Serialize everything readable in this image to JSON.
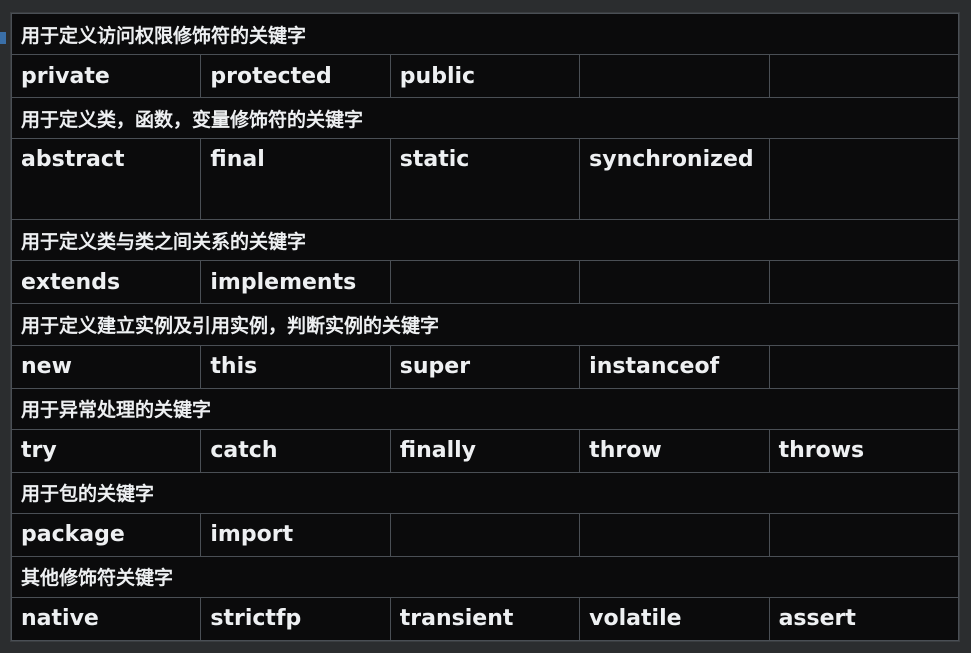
{
  "sections": [
    {
      "category": "用于定义访问权限修饰符的关键字",
      "keywords": [
        "private",
        "protected",
        "public",
        "",
        ""
      ]
    },
    {
      "category": "用于定义类，函数，变量修饰符的关键字",
      "keywords": [
        "abstract",
        "final",
        "static",
        "synchronized",
        ""
      ]
    },
    {
      "category": "用于定义类与类之间关系的关键字",
      "keywords": [
        "extends",
        "implements",
        "",
        "",
        ""
      ]
    },
    {
      "category": "用于定义建立实例及引用实例，判断实例的关键字",
      "keywords": [
        "new",
        "this",
        "super",
        "instanceof",
        ""
      ]
    },
    {
      "category": "用于异常处理的关键字",
      "keywords": [
        "try",
        "catch",
        "finally",
        "throw",
        "throws"
      ]
    },
    {
      "category": "用于包的关键字",
      "keywords": [
        "package",
        "import",
        "",
        "",
        ""
      ]
    },
    {
      "category": "其他修饰符关键字",
      "keywords": [
        "native",
        "strictfp",
        "transient",
        "volatile",
        "assert"
      ]
    }
  ],
  "colors": {
    "background": "#0b0b0c",
    "text": "#eef0f2",
    "grid": "#4a4f55"
  }
}
